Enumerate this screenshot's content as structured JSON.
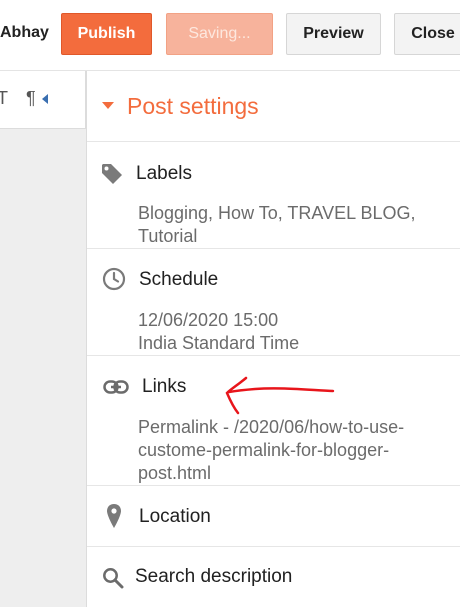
{
  "header": {
    "user_name": "Abhay",
    "publish_label": "Publish",
    "saving_label": "Saving...",
    "preview_label": "Preview",
    "close_label": "Close"
  },
  "toolbar": {
    "glyph_a": "T",
    "glyph_b": "¶"
  },
  "panel": {
    "title": "Post settings",
    "labels": {
      "title": "Labels",
      "value": "Blogging, How To, TRAVEL BLOG, Tutorial"
    },
    "schedule": {
      "title": "Schedule",
      "date": "12/06/2020 15:00",
      "timezone": "India Standard Time"
    },
    "links": {
      "title": "Links",
      "value": "Permalink - /2020/06/how-to-use-custome-permalink-for-blogger-post.html"
    },
    "location": {
      "title": "Location"
    },
    "search": {
      "title": "Search description"
    }
  },
  "colors": {
    "accent": "#f36c3d",
    "highlight": "#ffff1a",
    "annotation_arrow": "#e8151b"
  },
  "icons": [
    "tag-icon",
    "clock-icon",
    "link-icon",
    "location-pin-icon",
    "search-icon"
  ]
}
